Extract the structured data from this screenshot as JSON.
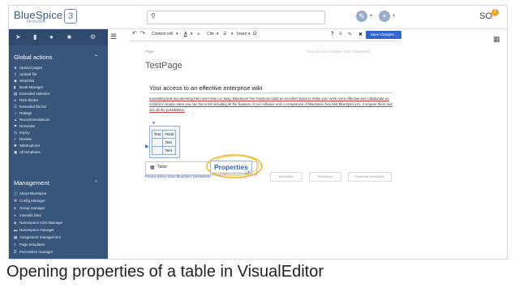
{
  "app": {
    "logo": "BlueSpice",
    "logo_sub": "MediaWiki",
    "logo_mark": "3",
    "user_initials": "SO",
    "notification_count": "1"
  },
  "search": {
    "icon": "search-icon",
    "placeholder": ""
  },
  "sidebar": {
    "sections": [
      {
        "title": "Global actions",
        "items": [
          {
            "label": "Special pages",
            "icon": "star-icon"
          },
          {
            "label": "Upload file",
            "icon": "upload-icon"
          },
          {
            "label": "Watchlist",
            "icon": "eye-icon"
          },
          {
            "label": "Book Manager",
            "icon": "book-icon"
          },
          {
            "label": "Extended statistics",
            "icon": "chart-icon"
          },
          {
            "label": "RSS feeder",
            "icon": "rss-icon"
          },
          {
            "label": "Extended file list",
            "icon": "list-icon"
          },
          {
            "label": "Ratings",
            "icon": "star-icon"
          },
          {
            "label": "Recommendations",
            "icon": "thumb-icon"
          },
          {
            "label": "Reminder",
            "icon": "flag-icon"
          },
          {
            "label": "Expiry",
            "icon": "clock-icon"
          },
          {
            "label": "Review",
            "icon": "check-icon"
          },
          {
            "label": "WikiExplorer",
            "icon": "compass-icon"
          },
          {
            "label": "All templates",
            "icon": "template-icon"
          }
        ]
      },
      {
        "title": "Management",
        "items": [
          {
            "label": "About BlueSpice",
            "icon": "info-icon"
          },
          {
            "label": "Config Manager",
            "icon": "wrench-icon"
          },
          {
            "label": "Group manager",
            "icon": "users-icon"
          },
          {
            "label": "Interwiki links",
            "icon": "link-icon"
          },
          {
            "label": "Namespace CSS Manager",
            "icon": "css-icon"
          },
          {
            "label": "Namespace manager",
            "icon": "folder-icon"
          },
          {
            "label": "Assignment management",
            "icon": "assign-icon"
          },
          {
            "label": "Page templates",
            "icon": "page-icon"
          },
          {
            "label": "Permission manager",
            "icon": "key-icon"
          }
        ]
      }
    ]
  },
  "toolbar": {
    "undo": "↶",
    "redo": "↷",
    "paragraph": "Content cell",
    "text_style": "A",
    "cite": "Cite",
    "insert": "Insert",
    "omega": "Ω",
    "help": "?",
    "menu": "≡",
    "save_label": "Save changes..."
  },
  "page": {
    "breadcrumb": "Page",
    "actions": "Discuss and Activities   Mod (Appended)",
    "title": "TestPage",
    "heading": "Your access to an effective enterprise wiki",
    "paragraph": "Innovating and documenting has never been so easy. BlueSpice free functions build an excellent basis to make your work more effective and collaborate on content in teams. Here you can find a list including all the features of our software and a comparison of BlueSpice free and BlueSpice pro. Compare them and see all the possibilities."
  },
  "table": {
    "rows": [
      [
        "Test",
        "Test2"
      ],
      [
        "",
        "Test"
      ],
      [
        "",
        "Test"
      ]
    ]
  },
  "context": {
    "table_label": "Table",
    "properties_label": "Properties"
  },
  "footer": {
    "links": "Privacy policy   About BlueSpice   Disclaimers",
    "badges": [
      "MediaWiki",
      "BlueSpice",
      "Semantic MediaWiki"
    ]
  },
  "caption": "Opening properties of a table in VisualEditor"
}
